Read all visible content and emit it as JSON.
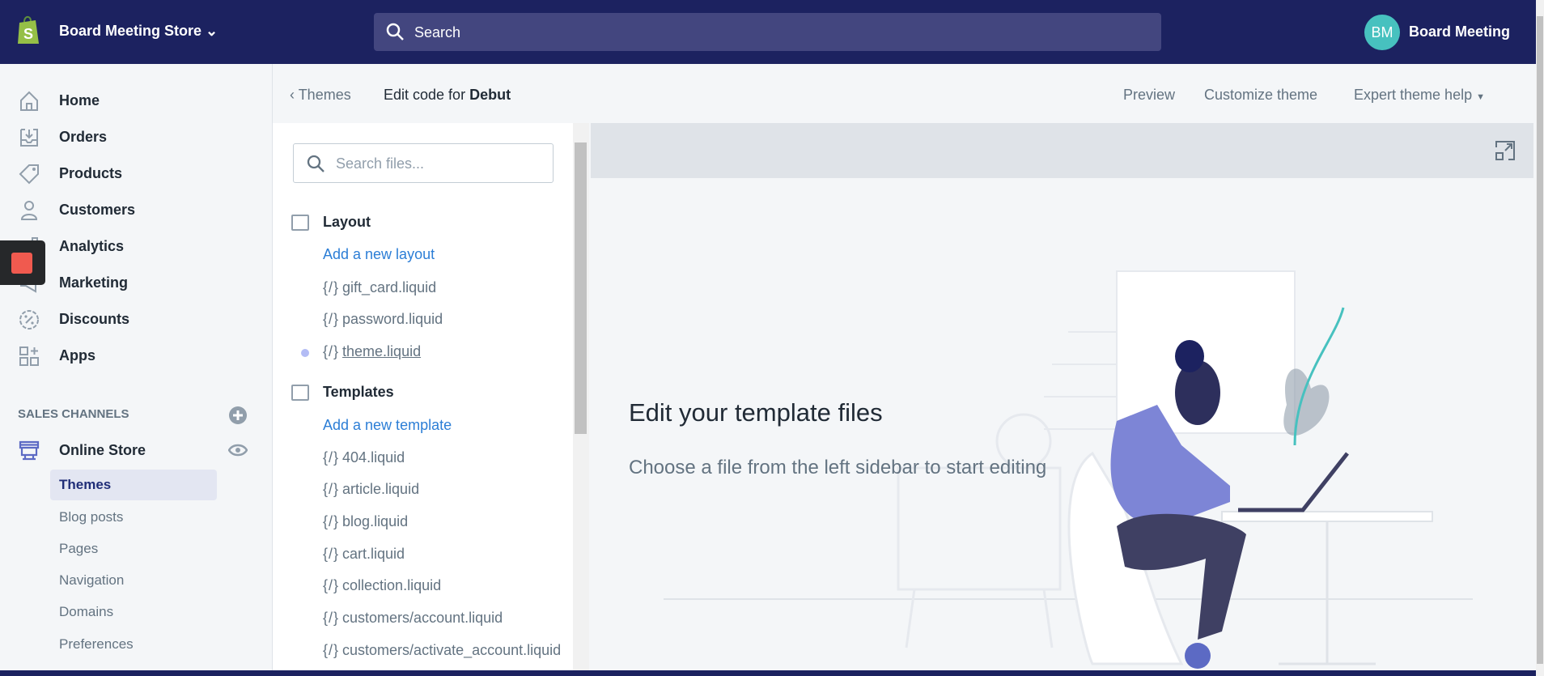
{
  "topbar": {
    "store_name": "Board Meeting Store",
    "search_placeholder": "Search",
    "avatar_initials": "BM",
    "user_name": "Board Meeting",
    "brand_color": "#1c2260"
  },
  "sidebar": {
    "items": [
      {
        "label": "Home",
        "icon": "home-icon"
      },
      {
        "label": "Orders",
        "icon": "orders-icon"
      },
      {
        "label": "Products",
        "icon": "tag-icon"
      },
      {
        "label": "Customers",
        "icon": "person-icon"
      },
      {
        "label": "Analytics",
        "icon": "analytics-icon"
      },
      {
        "label": "Marketing",
        "icon": "marketing-icon"
      },
      {
        "label": "Discounts",
        "icon": "discount-icon"
      },
      {
        "label": "Apps",
        "icon": "apps-icon"
      }
    ],
    "sales_channels_label": "SALES CHANNELS",
    "online_store": "Online Store",
    "sub_items": [
      "Themes",
      "Blog posts",
      "Pages",
      "Navigation",
      "Domains",
      "Preferences"
    ],
    "active_sub": "Themes"
  },
  "header": {
    "back_label": "Themes",
    "title_prefix": "Edit code for",
    "theme_name": "Debut",
    "preview": "Preview",
    "customize": "Customize theme",
    "expert_help": "Expert theme help"
  },
  "files": {
    "search_placeholder": "Search files...",
    "layout": {
      "title": "Layout",
      "add": "Add a new layout",
      "items": [
        "gift_card.liquid",
        "password.liquid",
        "theme.liquid"
      ]
    },
    "templates": {
      "title": "Templates",
      "add": "Add a new template",
      "items": [
        "404.liquid",
        "article.liquid",
        "blog.liquid",
        "cart.liquid",
        "collection.liquid",
        "customers/account.liquid",
        "customers/activate_account.liquid"
      ]
    },
    "icon_glyph": "{/}"
  },
  "editor": {
    "title": "Edit your template files",
    "subtitle": "Choose a file from the left sidebar to start editing"
  }
}
